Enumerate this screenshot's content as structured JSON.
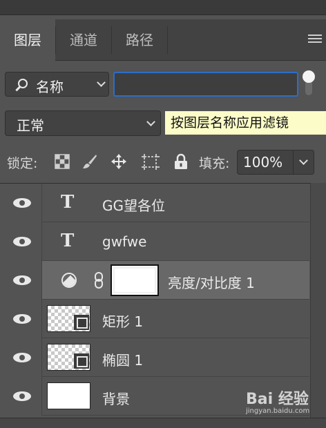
{
  "tabs": [
    {
      "label": "图层",
      "active": true
    },
    {
      "label": "通道",
      "active": false
    },
    {
      "label": "路径",
      "active": false
    }
  ],
  "filter": {
    "kind_label": "名称",
    "search_value": "",
    "search_placeholder": ""
  },
  "blend": {
    "mode": "正常",
    "tooltip": "按图层名称应用滤镜"
  },
  "lock": {
    "label": "锁定:",
    "icons": [
      "lock-transparent-icon",
      "lock-paint-icon",
      "lock-position-icon",
      "lock-artboard-icon",
      "lock-all-icon"
    ]
  },
  "fill": {
    "label": "填充:",
    "value": "100%"
  },
  "layers": [
    {
      "name": "GG望各位",
      "type": "text",
      "selected": false
    },
    {
      "name": "gwfwe",
      "type": "text",
      "selected": false
    },
    {
      "name": "亮度/对比度 1",
      "type": "adjustment",
      "selected": true
    },
    {
      "name": "矩形 1",
      "type": "shape",
      "selected": false
    },
    {
      "name": "椭圆 1",
      "type": "shape",
      "selected": false
    },
    {
      "name": "背景",
      "type": "background",
      "selected": false
    }
  ],
  "watermark": {
    "brand": "Bai 经验",
    "url": "jingyan.baidu.com"
  },
  "colors": {
    "panel": "#535353",
    "selected_row": "#686868",
    "focus": "#2b6ec9",
    "tooltip_bg": "#fcfcc8"
  }
}
